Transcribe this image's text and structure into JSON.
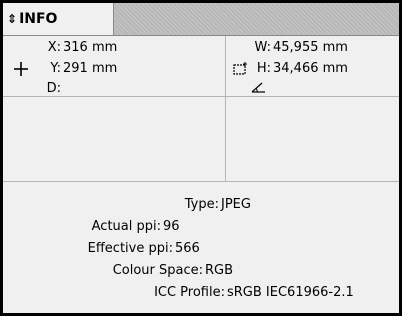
{
  "tab": {
    "title": "INFO",
    "icon": "expand-collapse-arrows-icon",
    "arrows_glyph": "⇕"
  },
  "position": {
    "x_label": "X:",
    "x_value": "316 mm",
    "y_label": "Y:",
    "y_value": "291 mm",
    "d_label": "D:"
  },
  "size": {
    "w_label": "W:",
    "w_value": "45,955 mm",
    "h_label": "H:",
    "h_value": "34,466 mm"
  },
  "image_info": {
    "type_label": "Type:",
    "type_value": "JPEG",
    "actual_ppi_label": "Actual ppi:",
    "actual_ppi_value": "96",
    "effective_ppi_label": "Effective ppi:",
    "effective_ppi_value": "566",
    "colour_space_label": "Colour Space:",
    "colour_space_value": "RGB",
    "icc_profile_label": "ICC Profile:",
    "icc_profile_value": "sRGB IEC61966-2.1"
  }
}
